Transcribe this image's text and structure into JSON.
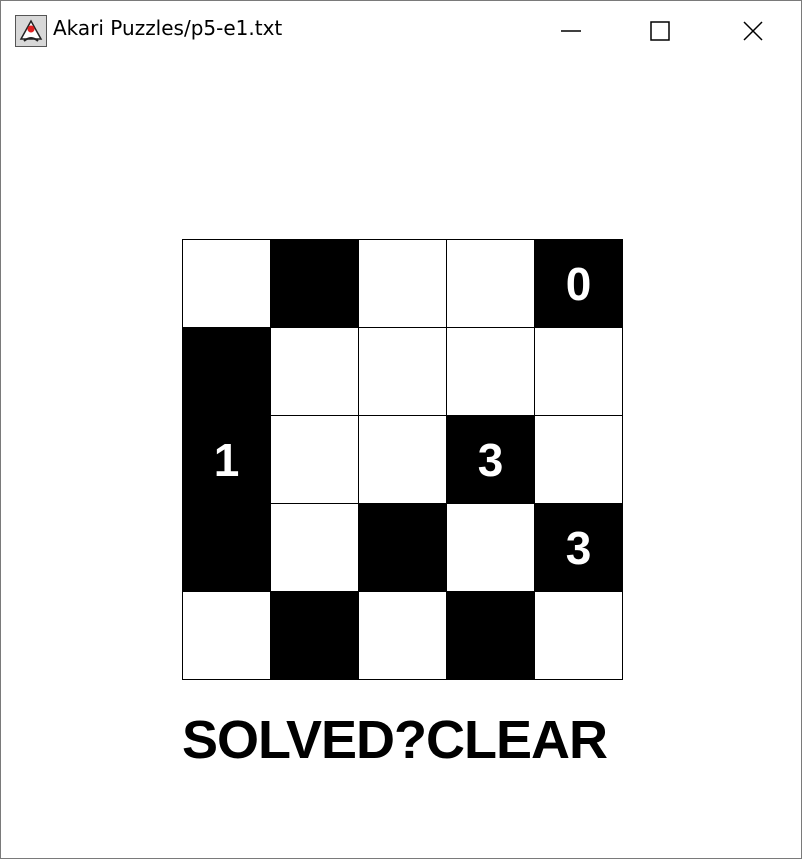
{
  "window": {
    "title": "Akari Puzzles/p5-e1.txt",
    "controls": {
      "minimize": "minimize-icon",
      "maximize": "maximize-icon",
      "close": "close-icon"
    }
  },
  "puzzle": {
    "size": 5,
    "cells": [
      [
        {
          "type": "white",
          "clue": ""
        },
        {
          "type": "black",
          "clue": ""
        },
        {
          "type": "white",
          "clue": ""
        },
        {
          "type": "white",
          "clue": ""
        },
        {
          "type": "black",
          "clue": "0"
        }
      ],
      [
        {
          "type": "black",
          "clue": ""
        },
        {
          "type": "white",
          "clue": ""
        },
        {
          "type": "white",
          "clue": ""
        },
        {
          "type": "white",
          "clue": ""
        },
        {
          "type": "white",
          "clue": ""
        }
      ],
      [
        {
          "type": "black",
          "clue": "1"
        },
        {
          "type": "white",
          "clue": ""
        },
        {
          "type": "white",
          "clue": ""
        },
        {
          "type": "black",
          "clue": "3"
        },
        {
          "type": "white",
          "clue": ""
        }
      ],
      [
        {
          "type": "black",
          "clue": ""
        },
        {
          "type": "white",
          "clue": ""
        },
        {
          "type": "black",
          "clue": ""
        },
        {
          "type": "white",
          "clue": ""
        },
        {
          "type": "black",
          "clue": "3"
        }
      ],
      [
        {
          "type": "white",
          "clue": ""
        },
        {
          "type": "black",
          "clue": ""
        },
        {
          "type": "white",
          "clue": ""
        },
        {
          "type": "black",
          "clue": ""
        },
        {
          "type": "white",
          "clue": ""
        }
      ]
    ]
  },
  "buttons": {
    "solved_label": "SOLVED?",
    "clear_label": "CLEAR"
  },
  "colors": {
    "wall": "#000000",
    "empty": "#ffffff",
    "clue_text": "#ffffff"
  }
}
